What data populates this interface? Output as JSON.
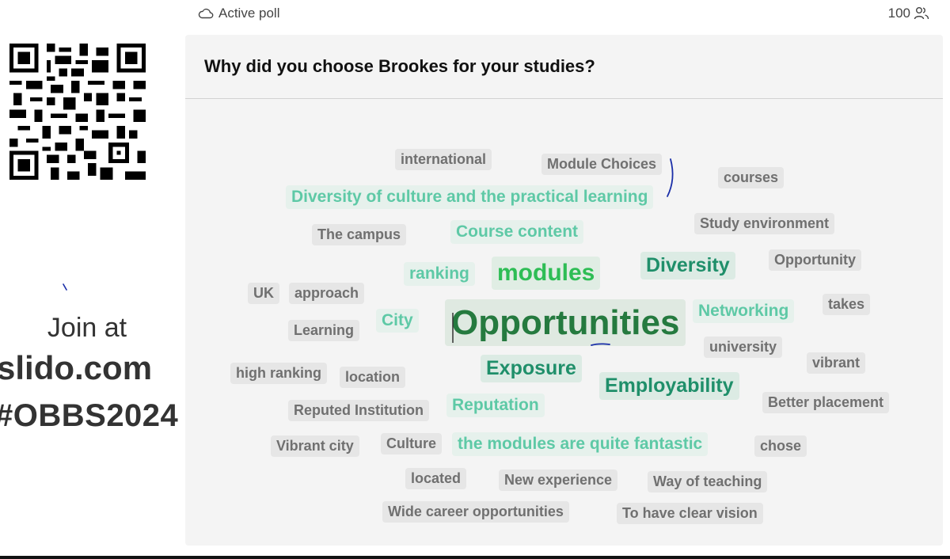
{
  "header": {
    "status_label": "Active poll",
    "participant_count": "100",
    "status_icon": "cloud-icon",
    "participant_icon": "people-icon"
  },
  "sidebar": {
    "qr_icon": "qr-code-icon",
    "join_label": "Join at",
    "join_domain": "slido.com",
    "event_code": "#OBBS2024"
  },
  "poll": {
    "question": "Why did you choose Brookes for your studies?",
    "words": {
      "international": "international",
      "module_choices": "Module Choices",
      "courses": "courses",
      "diversity_culture": "Diversity of culture and the practical learning",
      "study_environment": "Study environment",
      "the_campus": "The campus",
      "course_content": "Course content",
      "opportunity": "Opportunity",
      "ranking": "ranking",
      "modules": "modules",
      "diversity": "Diversity",
      "uk": "UK",
      "approach": "approach",
      "takes": "takes",
      "networking": "Networking",
      "city": "City",
      "learning": "Learning",
      "opportunities": "Opportunities",
      "university": "university",
      "vibrant": "vibrant",
      "high_ranking": "high ranking",
      "location": "location",
      "exposure": "Exposure",
      "employability": "Employability",
      "better_placement": "Better placement",
      "reputed_institution": "Reputed Institution",
      "reputation": "Reputation",
      "vibrant_city": "Vibrant city",
      "culture": "Culture",
      "modules_fantastic": "the modules are quite fantastic",
      "chose": "chose",
      "located": "located",
      "new_experience": "New experience",
      "way_of_teaching": "Way of teaching",
      "wide_career": "Wide career opportunities",
      "clear_vision": "To have clear vision"
    }
  },
  "colors": {
    "card_bg": "#f4f4f4",
    "word_gray": "#707070",
    "word_teal_light": "#5ec9a6",
    "word_teal": "#1f8f6a",
    "word_green": "#2ebd55",
    "word_green_dark": "#257a3f",
    "annotation_ink": "#1a2ea8"
  }
}
